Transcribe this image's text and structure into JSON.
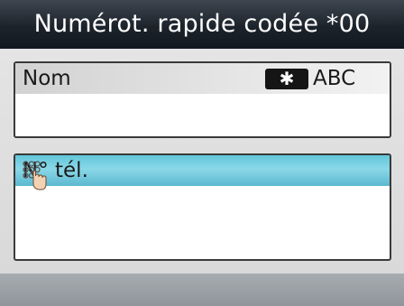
{
  "header": {
    "title": "Numérot. rapide codée *00"
  },
  "fields": {
    "name": {
      "label": "Nom",
      "value": "",
      "mode_key": "✱",
      "mode_label": "ABC"
    },
    "phone": {
      "label": "N° tél.",
      "value": "",
      "icon": "keypad-touch-icon"
    }
  },
  "colors": {
    "title_bg": "#1c232b",
    "highlight": "#7fd3e4",
    "border": "#3a3a3a",
    "background": "#dcdcdc"
  }
}
